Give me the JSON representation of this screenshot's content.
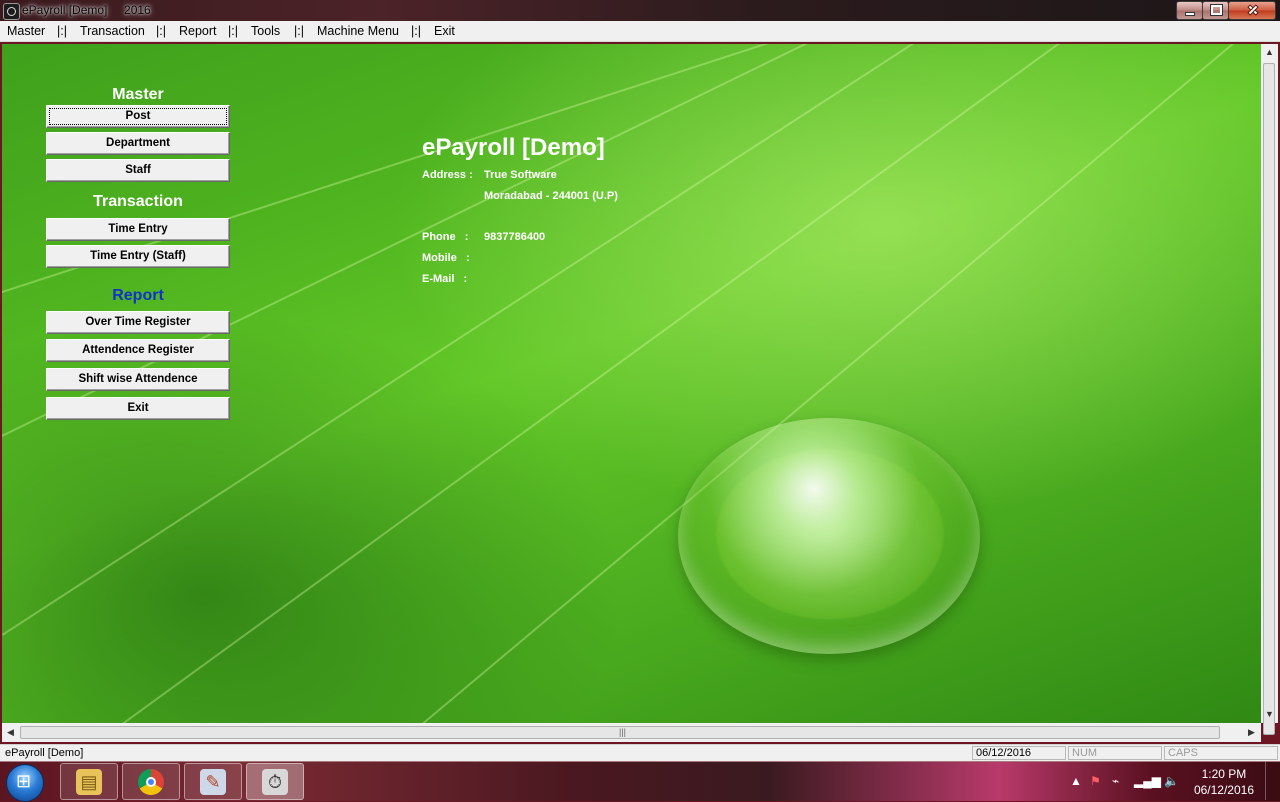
{
  "window": {
    "title": "ePayroll [Demo]     2016"
  },
  "menu": [
    "Master",
    "|:|",
    "Transaction",
    "|:|",
    "Report",
    "|:|",
    "Tools",
    "|:|",
    "Machine Menu",
    "|:|",
    "Exit"
  ],
  "sidebar": {
    "master_title": "Master",
    "post": "Post",
    "department": "Department",
    "staff": "Staff",
    "transaction_title": "Transaction",
    "time_entry": "Time  Entry",
    "time_entry_staff": "Time Entry (Staff)",
    "report_title": "Report",
    "overtime_register": "Over Time Register",
    "attendence_register": "Attendence Register",
    "shift_wise": "Shift wise Attendence",
    "exit": "Exit"
  },
  "company": {
    "name": "ePayroll [Demo]",
    "address_label": "Address :",
    "address_line1": "True Software",
    "address_line2": "Moradabad - 244001 (U.P)",
    "phone_label": "Phone   :",
    "phone": "9837786400",
    "mobile_label": "Mobile   :",
    "email_label": "E-Mail   :"
  },
  "status": {
    "app": "ePayroll [Demo]",
    "date": "06/12/2016",
    "num": "NUM",
    "caps": "CAPS"
  },
  "taskbar": {
    "time": "1:20 PM",
    "date": "06/12/2016"
  },
  "colors": {
    "report_title": "#1033cc",
    "section_title": "#ffffff",
    "leaf_green": "#4fb41f"
  }
}
